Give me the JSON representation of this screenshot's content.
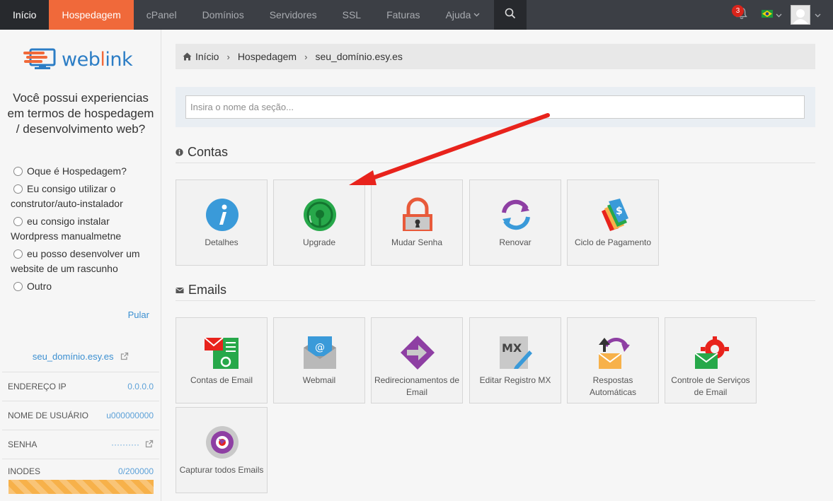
{
  "nav": {
    "home": "Início",
    "items": [
      "Hospedagem",
      "cPanel",
      "Domínios",
      "Servidores",
      "SSL",
      "Faturas"
    ],
    "help": "Ajuda",
    "notification_count": "3"
  },
  "sidebar": {
    "question": "Você possui experiencias em termos de hospedagem / desenvolvimento web?",
    "options": [
      "Oque é Hospedagem?",
      "Eu consigo utilizar o construtor/auto-instalador",
      "eu consigo instalar Wordpress manualmetne",
      "eu posso desenvolver um website de um rascunho",
      "Outro"
    ],
    "skip": "Pular",
    "domain": "seu_domínio.esy.es",
    "info": [
      {
        "label": "ENDEREÇO IP",
        "value": "0.0.0.0"
      },
      {
        "label": "NOME DE USUÁRIO",
        "value": "u000000000"
      },
      {
        "label": "SENHA",
        "value": "··········"
      },
      {
        "label": "INODES",
        "value": "0/200000"
      }
    ],
    "inodes_fill_percent": 100
  },
  "breadcrumb": [
    "Início",
    "Hospedagem",
    "seu_domínio.esy.es"
  ],
  "search": {
    "placeholder": "Insira o nome da seção..."
  },
  "sections": {
    "contas": {
      "title": "Contas",
      "tiles": [
        "Detalhes",
        "Upgrade",
        "Mudar Senha",
        "Renovar",
        "Ciclo de Pagamento"
      ]
    },
    "emails": {
      "title": "Emails",
      "tiles": [
        "Contas de Email",
        "Webmail",
        "Redirecionamentos de Email",
        "Editar Registro MX",
        "Respostas Automáticas",
        "Controle de Serviços de Email",
        "Capturar todos Emails"
      ]
    }
  },
  "colors": {
    "accent": "#f0693a",
    "nav_bg": "#3c3f45",
    "link": "#3b8fd1",
    "arrow": "#e8231c"
  }
}
